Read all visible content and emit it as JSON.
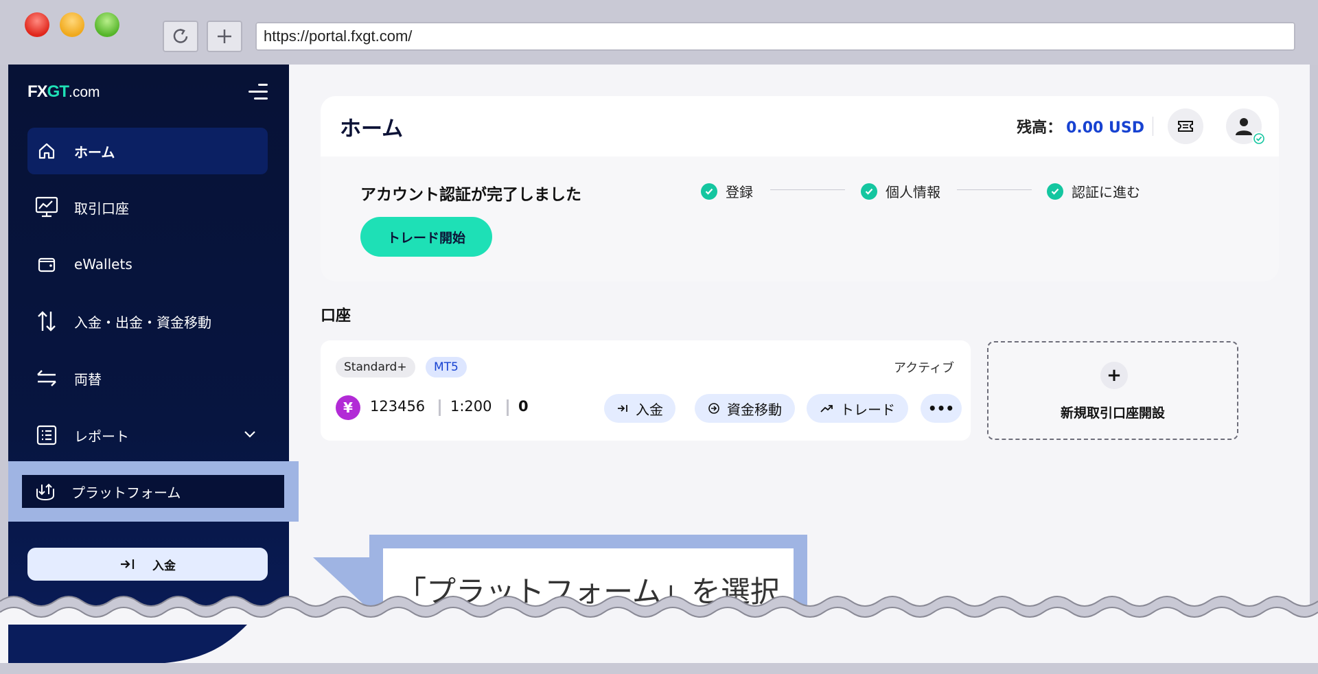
{
  "browser": {
    "url": "https://portal.fxgt.com/"
  },
  "sidebar": {
    "logo": {
      "part1": "FX",
      "part2": "GT",
      "part3": ".com"
    },
    "items": [
      {
        "label": "ホーム",
        "icon": "home-icon"
      },
      {
        "label": "取引口座",
        "icon": "monitor-chart-icon"
      },
      {
        "label": "eWallets",
        "icon": "wallet-icon"
      },
      {
        "label": "入金・出金・資金移動",
        "icon": "arrows-updown-icon"
      },
      {
        "label": "両替",
        "icon": "exchange-icon"
      },
      {
        "label": "レポート",
        "icon": "report-list-icon"
      },
      {
        "label": "プラットフォーム",
        "icon": "platform-icon"
      }
    ],
    "deposit_label": "入金"
  },
  "header": {
    "title": "ホーム",
    "balance_label": "残高：",
    "balance_value": "0.00 USD"
  },
  "verification": {
    "title": "アカウント認証が完了しました",
    "steps": [
      "登録",
      "個人情報",
      "認証に進む"
    ],
    "trade_button": "トレード開始"
  },
  "accounts": {
    "section_label": "口座",
    "card": {
      "tag_type": "Standard+",
      "tag_platform": "MT5",
      "status": "アクティブ",
      "currency_symbol": "¥",
      "number": "123456",
      "leverage": "1:200",
      "balance": "0",
      "actions": [
        "入金",
        "資金移動",
        "トレード"
      ],
      "more": "•••"
    },
    "new_account_label": "新規取引口座開設",
    "new_account_plus": "+"
  },
  "callout": {
    "text": "「プラットフォーム」を選択"
  },
  "colors": {
    "sidebar_bg": "#071236",
    "accent_teal": "#1ee0b6",
    "link_blue": "#1742d1",
    "highlight_blue": "#9fb4e3"
  }
}
